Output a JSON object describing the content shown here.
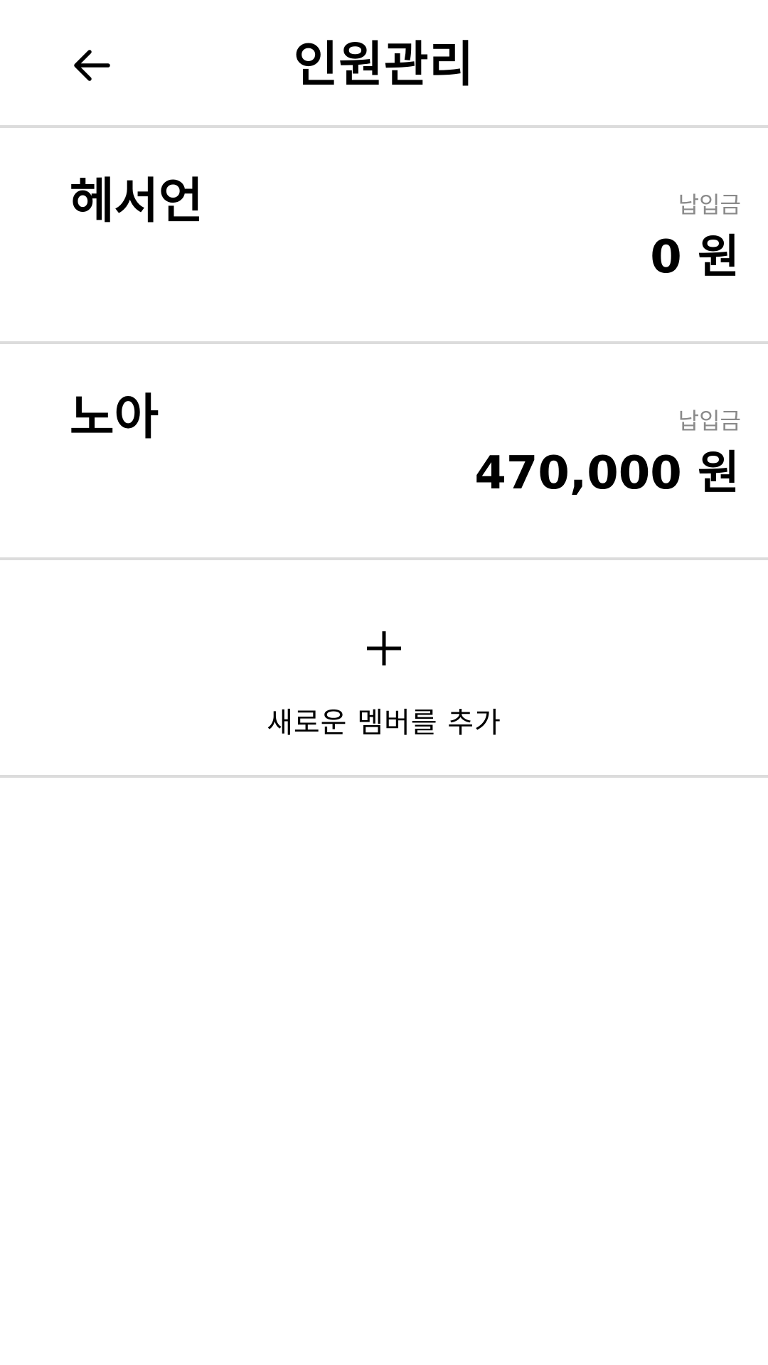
{
  "header": {
    "back_icon": "arrow-left-icon",
    "title": "인원관리"
  },
  "members": [
    {
      "name": "헤서언",
      "payment_label": "납입금",
      "payment_amount": "0 원"
    },
    {
      "name": "노아",
      "payment_label": "납입금",
      "payment_amount": "470,000 원"
    }
  ],
  "add_member": {
    "icon": "plus-icon",
    "label": "새로운 멤버를 추가"
  },
  "colors": {
    "background": "#ffffff",
    "divider": "#dcdcdc",
    "secondary_text": "#8a8a8a",
    "primary_text": "#000000"
  }
}
